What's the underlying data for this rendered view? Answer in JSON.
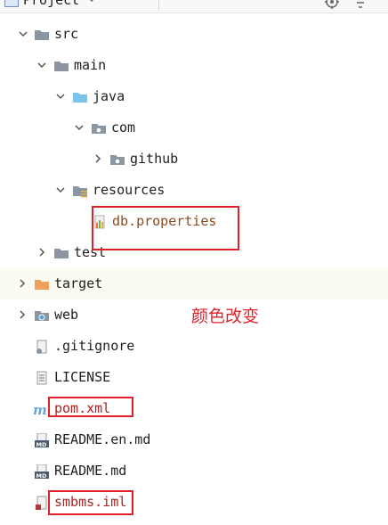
{
  "panel": {
    "title": "Project",
    "tools": [
      "locate-icon",
      "collapse-all-icon"
    ]
  },
  "tree": [
    {
      "label": "src",
      "icon": "folder-icon",
      "expanded": true,
      "depth": 1
    },
    {
      "label": "main",
      "icon": "folder-icon",
      "expanded": true,
      "depth": 2
    },
    {
      "label": "java",
      "icon": "source-folder-icon",
      "expanded": true,
      "depth": 3
    },
    {
      "label": "com",
      "icon": "package-icon",
      "expanded": true,
      "depth": 4
    },
    {
      "label": "github",
      "icon": "package-icon",
      "expanded": false,
      "depth": 5
    },
    {
      "label": "resources",
      "icon": "resources-folder-icon",
      "expanded": true,
      "depth": 3
    },
    {
      "label": "db.properties",
      "icon": "properties-file-icon",
      "depth": 4
    },
    {
      "label": "test",
      "icon": "folder-icon",
      "expanded": false,
      "depth": 2
    },
    {
      "label": "target",
      "icon": "excluded-folder-icon",
      "expanded": false,
      "depth": 1
    },
    {
      "label": "web",
      "icon": "web-folder-icon",
      "expanded": false,
      "depth": 1
    },
    {
      "label": ".gitignore",
      "icon": "gitignore-file-icon",
      "depth": 1
    },
    {
      "label": "LICENSE",
      "icon": "text-file-icon",
      "depth": 1
    },
    {
      "label": "pom.xml",
      "icon": "maven-file-icon",
      "depth": 1
    },
    {
      "label": "README.en.md",
      "icon": "markdown-file-icon",
      "depth": 1
    },
    {
      "label": "README.md",
      "icon": "markdown-file-icon",
      "depth": 1
    },
    {
      "label": "smbms.iml",
      "icon": "module-file-icon",
      "depth": 1
    }
  ],
  "annotation": "颜色改变",
  "colors": {
    "highlight": "#e0202a",
    "modified_text": "#8b4b1e",
    "folder": "#8c96a1",
    "source_folder": "#79c4e8",
    "excluded_folder": "#f0a05a"
  }
}
